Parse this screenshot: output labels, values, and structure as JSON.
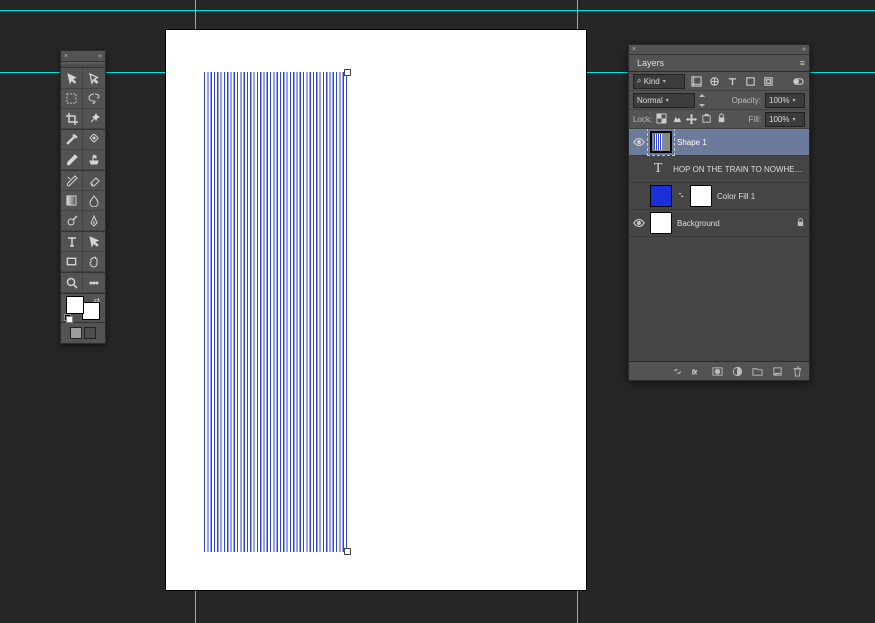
{
  "guides": {
    "h": [
      10,
      72
    ],
    "v": [
      195,
      577
    ]
  },
  "tools": {
    "rows": [
      [
        "move-tool",
        "direct-select-tool"
      ],
      [
        "marquee-tool",
        "lasso-tool"
      ],
      [
        "crop-tool",
        "magic-wand-tool"
      ],
      [
        "eyedropper-tool",
        "spot-heal-tool"
      ],
      [
        "brush-tool",
        "clone-stamp-tool"
      ],
      [
        "history-brush-tool",
        "eraser-tool"
      ],
      [
        "gradient-tool",
        "blur-tool"
      ],
      [
        "dodge-tool",
        "pen-tool"
      ],
      [
        "type-tool",
        "path-select-tool"
      ],
      [
        "rectangle-tool",
        "hand-tool"
      ],
      [
        "zoom-tool",
        "edit-toolbar"
      ]
    ]
  },
  "layers_panel": {
    "tab": "Layers",
    "filter": {
      "kind_label": "Kind"
    },
    "blend": {
      "mode": "Normal",
      "opacity_label": "Opacity:",
      "opacity": "100%"
    },
    "lock": {
      "label": "Lock:",
      "fill_label": "Fill:",
      "fill": "100%"
    },
    "layers": [
      {
        "name": "Shape 1",
        "kind": "shape",
        "visible": true,
        "selected": true
      },
      {
        "name": "HOP ON THE TRAIN TO NOWHERE BABY",
        "kind": "text",
        "visible": false,
        "selected": false
      },
      {
        "name": "Color Fill 1",
        "kind": "fill",
        "visible": false,
        "selected": false,
        "fill_color": "#1a2fd8"
      },
      {
        "name": "Background",
        "kind": "raster",
        "visible": true,
        "selected": false,
        "locked": true
      }
    ],
    "footer_buttons": [
      "link-layers",
      "fx",
      "layer-mask",
      "adjustment-layer",
      "group",
      "new-layer",
      "delete-layer"
    ]
  }
}
